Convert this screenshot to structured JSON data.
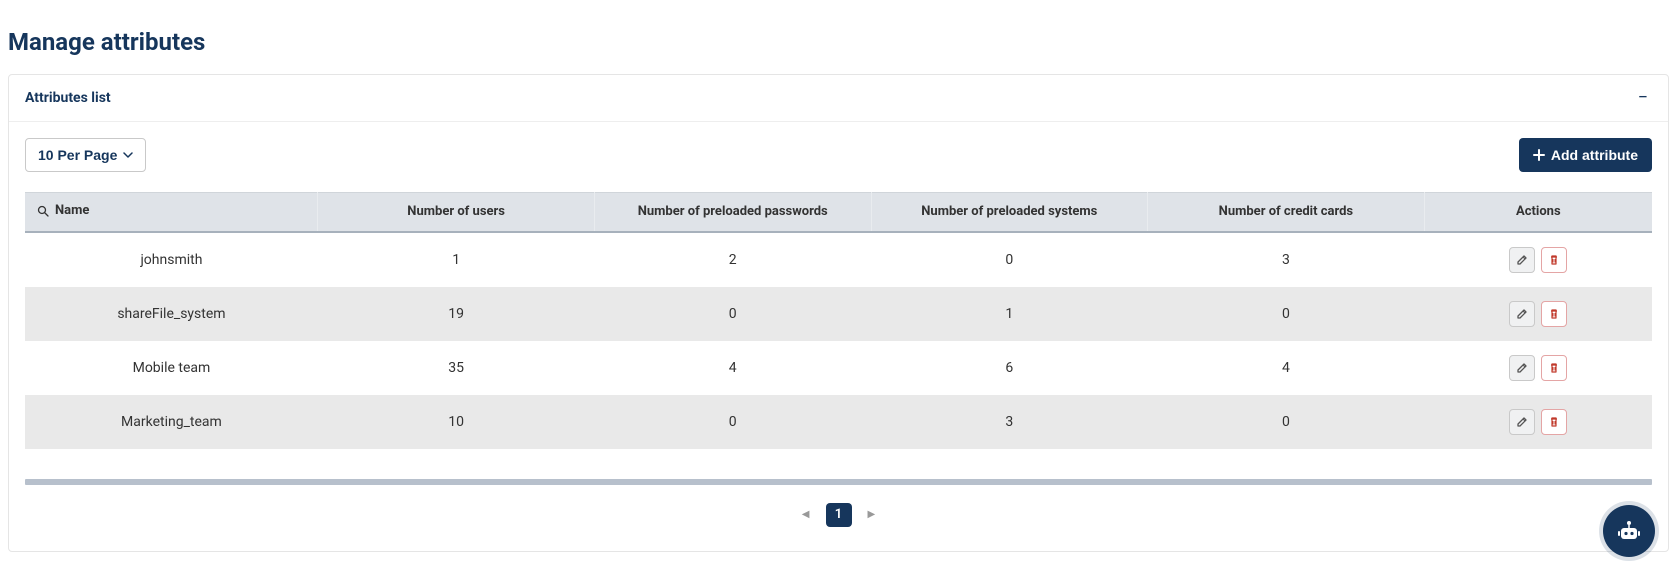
{
  "page": {
    "title": "Manage attributes"
  },
  "panel": {
    "title": "Attributes list"
  },
  "controls": {
    "per_page_label": "10 Per Page",
    "add_button_label": "Add attribute"
  },
  "table": {
    "columns": {
      "name": "Name",
      "users": "Number of users",
      "preloaded_passwords": "Number of preloaded passwords",
      "preloaded_systems": "Number of preloaded systems",
      "credit_cards": "Number of credit cards",
      "actions": "Actions"
    },
    "rows": [
      {
        "name": "johnsmith",
        "users": "1",
        "preloaded_passwords": "2",
        "preloaded_systems": "0",
        "credit_cards": "3"
      },
      {
        "name": "shareFile_system",
        "users": "19",
        "preloaded_passwords": "0",
        "preloaded_systems": "1",
        "credit_cards": "0"
      },
      {
        "name": "Mobile team",
        "users": "35",
        "preloaded_passwords": "4",
        "preloaded_systems": "6",
        "credit_cards": "4"
      },
      {
        "name": "Marketing_team",
        "users": "10",
        "preloaded_passwords": "0",
        "preloaded_systems": "3",
        "credit_cards": "0"
      }
    ]
  },
  "pagination": {
    "current": "1"
  }
}
